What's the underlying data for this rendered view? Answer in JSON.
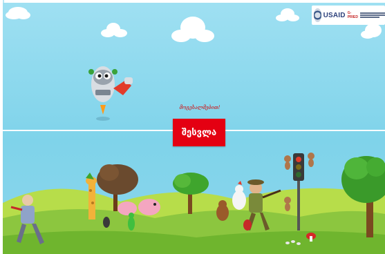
{
  "logo": {
    "brand": "USAID",
    "program": "G-PRIED"
  },
  "welcome_text": "მოგესალმებით!",
  "enter_button": {
    "label": "შესვლა"
  },
  "colors": {
    "sky": "#8fd8ee",
    "button_bg": "#e40012",
    "button_text": "#ffffff",
    "welcome_text": "#d60000",
    "grass": "#8cc63f"
  },
  "icons": [
    "robot-mascot-icon",
    "traffic-light-icon",
    "tree-icon",
    "cloud-icon"
  ]
}
